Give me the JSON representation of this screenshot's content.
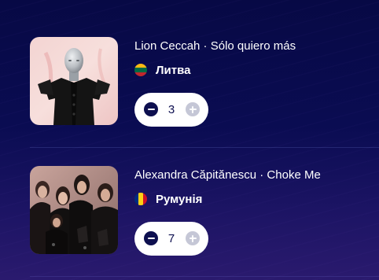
{
  "entries": [
    {
      "title": "Lion Ceccah · Sólo quiero más",
      "country": "Литва",
      "flag_icon": "lithuania-flag-icon",
      "flag_colors": [
        "#FDB913",
        "#006A44",
        "#C1272D"
      ],
      "votes": "3"
    },
    {
      "title": "Alexandra Căpitănescu · Choke Me",
      "country": "Румунія",
      "flag_icon": "romania-flag-icon",
      "flag_colors": [
        "#002B7F",
        "#FCD116",
        "#CE1126"
      ],
      "votes": "7"
    }
  ],
  "icons": {
    "decrement": "minus-icon",
    "increment": "plus-icon"
  },
  "colors": {
    "background": "#080a4a",
    "stepper_bg": "#ffffff",
    "minus_button": "#0d0f4f",
    "plus_button_disabled": "#c5c7d6"
  }
}
